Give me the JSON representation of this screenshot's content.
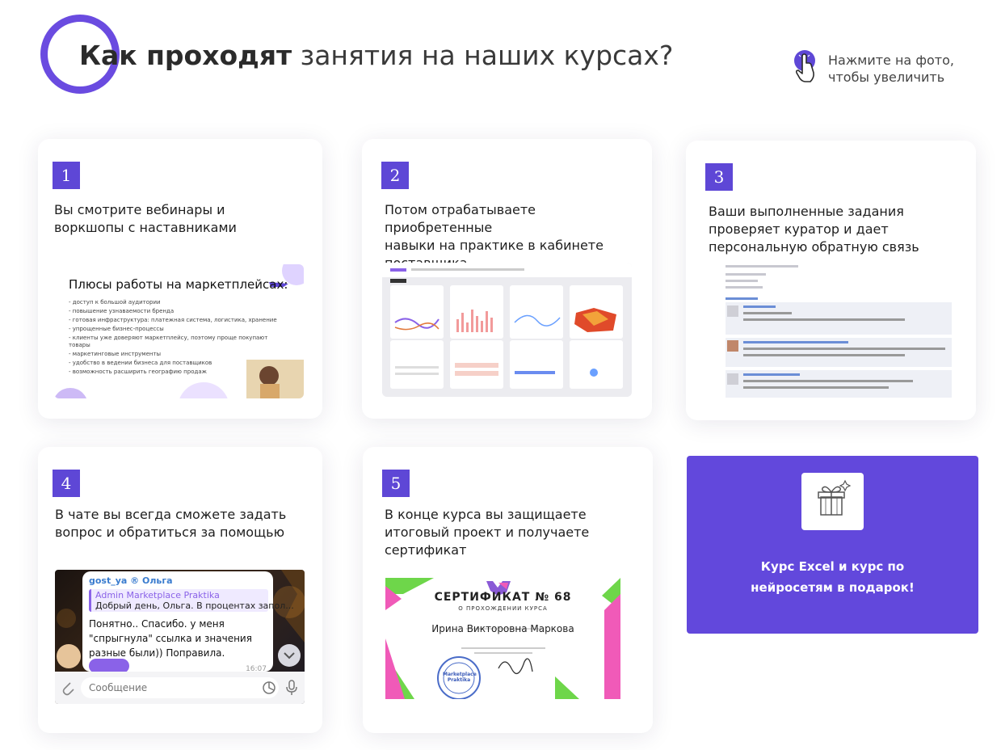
{
  "header": {
    "title_bold": "Как проходят",
    "title_light": "занятия на наших курсах?",
    "hint_line1": "Нажмите на фото,",
    "hint_line2": "чтобы увеличить"
  },
  "accent": "#5e47d6",
  "steps": [
    {
      "number": "1",
      "line1": "Вы смотрите вебинары и",
      "line2": "воркшопы с наставниками",
      "line3": ""
    },
    {
      "number": "2",
      "line1": "Потом отрабатываете приобретенные",
      "line2": "навыки на практике в кабинете",
      "line3": "поставщика"
    },
    {
      "number": "3",
      "line1": "Ваши выполненные задания",
      "line2": "проверяет куратор и дает",
      "line3": "персональную обратную связь"
    },
    {
      "number": "4",
      "line1": "В чате вы всегда сможете задать",
      "line2": "вопрос и обратиться за помощью",
      "line3": ""
    },
    {
      "number": "5",
      "line1": "В конце курса вы защищаете",
      "line2": "итоговый проект и получаете",
      "line3": "сертификат"
    }
  ],
  "promo": {
    "line1": "Курс Excel и курс по",
    "line2": "нейросетям в подарок!",
    "icon": "gift-icon"
  },
  "slide1": {
    "title": "Плюсы работы на маркетплейсах:",
    "items": [
      "- доступ к большой аудитории",
      "- повышение узнаваемости бренда",
      "- готовая инфраструктура: платежная система, логистика, хранение",
      "- упрощенные бизнес-процессы",
      "- клиенты уже доверяют маркетплейсу, поэтому проще покупают",
      "  товары",
      "- маркетинговые инструменты",
      "- удобство в ведении бизнеса для поставщиков",
      "- возможность расширить географию продаж"
    ]
  },
  "chat": {
    "sender": "gost_ya ® Ольга",
    "reply_author": "Admin Marketplace Praktika",
    "reply_text": "Добрый день, Ольга. В процентах запол...",
    "msg1": "Понятно.. Спасибо. у меня",
    "msg2": "\"спрыгнула\" ссылка и значения",
    "msg3": "разные были)) Поправила.",
    "time": "16:07",
    "placeholder": "Сообщение"
  },
  "certificate": {
    "title": "СЕРТИФИКАТ № 68",
    "subtitle": "О ПРОХОЖДЕНИИ КУРСА",
    "name": "Ирина Викторовна Маркова",
    "stamp": "Marketplace Praktika"
  }
}
